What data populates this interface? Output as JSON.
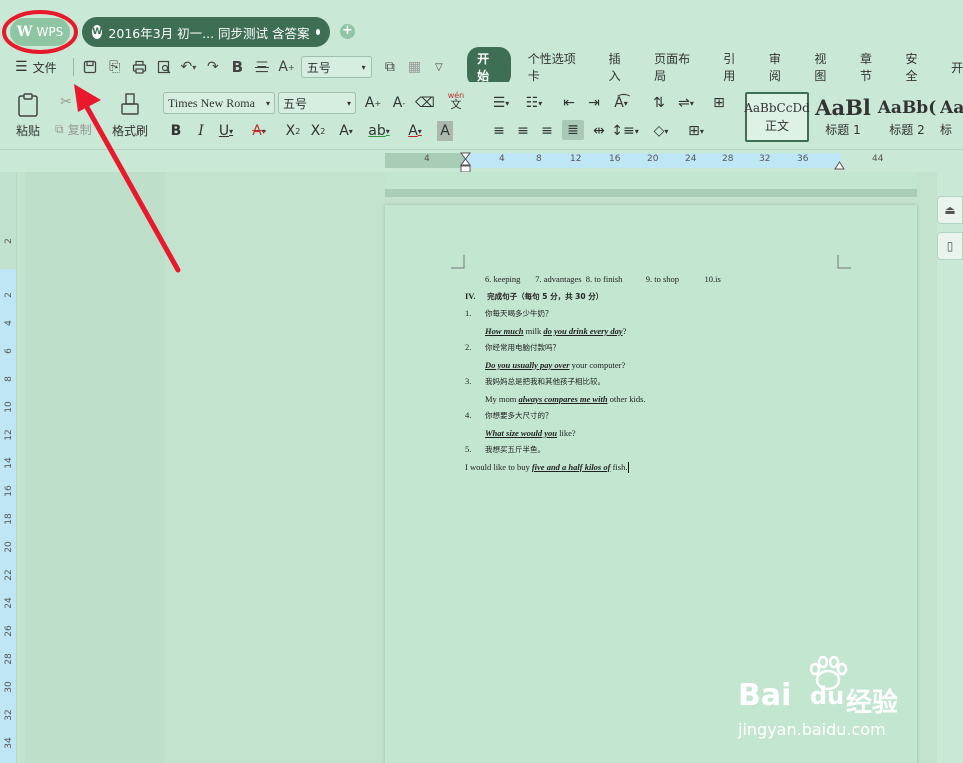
{
  "tabs": {
    "wps_label": "WPS",
    "doc_title": "2016年3月 初一... 同步测试 含答案"
  },
  "menubar": {
    "file_label": "文件",
    "font_size": "五号",
    "active_tab": "开始",
    "tabs": [
      "个性选项卡",
      "插入",
      "页面布局",
      "引用",
      "审阅",
      "视图",
      "章节",
      "安全",
      "开"
    ]
  },
  "ribbon": {
    "paste": "粘贴",
    "copy": "复制",
    "format_painter": "格式刷",
    "font_name": "Times New Roma",
    "font_size": "五号",
    "phonetic": "wén",
    "phonetic_sub": "文",
    "styles": [
      {
        "preview": "AaBbCcDd",
        "label": "正文"
      },
      {
        "preview": "AaBl",
        "label": "标题 1"
      },
      {
        "preview": "AaBb(",
        "label": "标题 2"
      },
      {
        "preview": "Aa",
        "label": "标"
      }
    ]
  },
  "hruler_ticks": [
    "4",
    "4",
    "8",
    "12",
    "16",
    "20",
    "24",
    "28",
    "32",
    "36",
    "44"
  ],
  "vruler_ticks": [
    "2",
    "2",
    "4",
    "6",
    "8",
    "10",
    "12",
    "14",
    "16",
    "18",
    "20",
    "22",
    "24",
    "26",
    "28",
    "30",
    "32",
    "34"
  ],
  "document": {
    "answers_line": "6. keeping       7. advantages  8. to finish           9. to shop            10.is",
    "section_num": "IV.",
    "section_title": "完成句子（每句 5 分，共 30 分）",
    "items": [
      {
        "num": "1.",
        "cn": "你每天喝多少牛奶？",
        "pre": "",
        "a1": "How much",
        "mid": " milk ",
        "a2": "do you drink every day",
        "post": "?"
      },
      {
        "num": "2.",
        "cn": "你经常用电脑付款吗？",
        "pre": "",
        "a1": "Do you usually pay over",
        "mid": " your computer?",
        "a2": "",
        "post": ""
      },
      {
        "num": "3.",
        "cn": "我妈妈总是把我和其他孩子相比较。",
        "pre": "My mom ",
        "a1": "always compares me with",
        "mid": " other kids.",
        "a2": "",
        "post": ""
      },
      {
        "num": "4.",
        "cn": "你想要多大尺寸的？",
        "pre": "",
        "a1": "What size would you",
        "mid": " like?",
        "a2": "",
        "post": ""
      },
      {
        "num": "5.",
        "cn": "我想买五斤半鱼。",
        "pre": "",
        "a1": "",
        "mid": "",
        "a2": "",
        "post": ""
      }
    ],
    "last_line_pre": "I would like to buy ",
    "last_line_answer": "five and a half kilos of",
    "last_line_post": " fish."
  },
  "watermark": {
    "brand": "Bai",
    "brand2": "du",
    "cn": "经验",
    "url": "jingyan.baidu.com"
  },
  "colors": {
    "annotation": "#e8192c",
    "accent": "#3e6f55"
  }
}
